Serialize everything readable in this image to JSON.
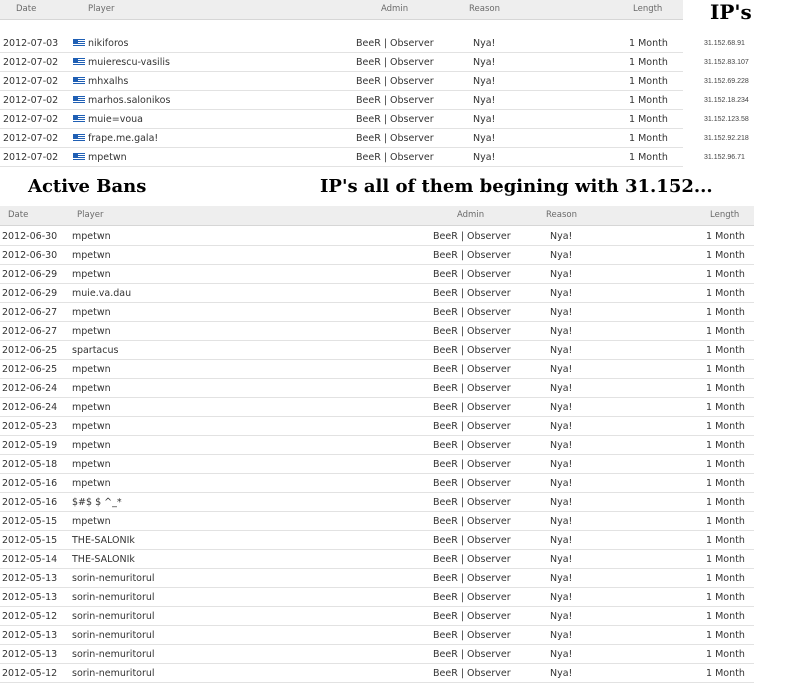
{
  "top_table": {
    "headers": {
      "date": "Date",
      "player": "Player",
      "admin": "Admin",
      "reason": "Reason",
      "length": "Length"
    },
    "rows": [
      {
        "date": "2012-07-03",
        "player": "nikiforos",
        "admin": "BeeR | Observer",
        "reason": "Nya!",
        "length": "1 Month"
      },
      {
        "date": "2012-07-02",
        "player": "muierescu-vasilis",
        "admin": "BeeR | Observer",
        "reason": "Nya!",
        "length": "1 Month"
      },
      {
        "date": "2012-07-02",
        "player": "mhxalhs",
        "admin": "BeeR | Observer",
        "reason": "Nya!",
        "length": "1 Month"
      },
      {
        "date": "2012-07-02",
        "player": "marhos.salonikos",
        "admin": "BeeR | Observer",
        "reason": "Nya!",
        "length": "1 Month"
      },
      {
        "date": "2012-07-02",
        "player": "muie=voua",
        "admin": "BeeR | Observer",
        "reason": "Nya!",
        "length": "1 Month"
      },
      {
        "date": "2012-07-02",
        "player": "frape.me.gala!",
        "admin": "BeeR | Observer",
        "reason": "Nya!",
        "length": "1 Month"
      },
      {
        "date": "2012-07-02",
        "player": "mpetwn",
        "admin": "BeeR | Observer",
        "reason": "Nya!",
        "length": "1 Month"
      }
    ]
  },
  "ips": {
    "title": "IP's",
    "values": [
      "31.152.68.91",
      "31.152.83.107",
      "31.152.69.228",
      "31.152.18.234",
      "31.152.123.58",
      "31.152.92.218",
      "31.152.96.71"
    ]
  },
  "annotations": {
    "active_bans": "Active Bans",
    "ips_note": "IP's all of them begining with 31.152..."
  },
  "bottom_table": {
    "headers": {
      "date": "Date",
      "player": "Player",
      "admin": "Admin",
      "reason": "Reason",
      "length": "Length"
    },
    "rows": [
      {
        "date": "2012-06-30",
        "player": "mpetwn",
        "admin": "BeeR | Observer",
        "reason": "Nya!",
        "length": "1 Month"
      },
      {
        "date": "2012-06-30",
        "player": "mpetwn",
        "admin": "BeeR | Observer",
        "reason": "Nya!",
        "length": "1 Month"
      },
      {
        "date": "2012-06-29",
        "player": "mpetwn",
        "admin": "BeeR | Observer",
        "reason": "Nya!",
        "length": "1 Month"
      },
      {
        "date": "2012-06-29",
        "player": "muie.va.dau",
        "admin": "BeeR | Observer",
        "reason": "Nya!",
        "length": "1 Month"
      },
      {
        "date": "2012-06-27",
        "player": "mpetwn",
        "admin": "BeeR | Observer",
        "reason": "Nya!",
        "length": "1 Month"
      },
      {
        "date": "2012-06-27",
        "player": "mpetwn",
        "admin": "BeeR | Observer",
        "reason": "Nya!",
        "length": "1 Month"
      },
      {
        "date": "2012-06-25",
        "player": "spartacus",
        "admin": "BeeR | Observer",
        "reason": "Nya!",
        "length": "1 Month"
      },
      {
        "date": "2012-06-25",
        "player": "mpetwn",
        "admin": "BeeR | Observer",
        "reason": "Nya!",
        "length": "1 Month"
      },
      {
        "date": "2012-06-24",
        "player": "mpetwn",
        "admin": "BeeR | Observer",
        "reason": "Nya!",
        "length": "1 Month"
      },
      {
        "date": "2012-06-24",
        "player": "mpetwn",
        "admin": "BeeR | Observer",
        "reason": "Nya!",
        "length": "1 Month"
      },
      {
        "date": "2012-05-23",
        "player": "mpetwn",
        "admin": "BeeR | Observer",
        "reason": "Nya!",
        "length": "1 Month"
      },
      {
        "date": "2012-05-19",
        "player": "mpetwn",
        "admin": "BeeR | Observer",
        "reason": "Nya!",
        "length": "1 Month"
      },
      {
        "date": "2012-05-18",
        "player": "mpetwn",
        "admin": "BeeR | Observer",
        "reason": "Nya!",
        "length": "1 Month"
      },
      {
        "date": "2012-05-16",
        "player": "mpetwn",
        "admin": "BeeR | Observer",
        "reason": "Nya!",
        "length": "1 Month"
      },
      {
        "date": "2012-05-16",
        "player": "$#$ $ ^_*",
        "admin": "BeeR | Observer",
        "reason": "Nya!",
        "length": "1 Month"
      },
      {
        "date": "2012-05-15",
        "player": "mpetwn",
        "admin": "BeeR | Observer",
        "reason": "Nya!",
        "length": "1 Month"
      },
      {
        "date": "2012-05-15",
        "player": "THE-SALONIk",
        "admin": "BeeR | Observer",
        "reason": "Nya!",
        "length": "1 Month"
      },
      {
        "date": "2012-05-14",
        "player": "THE-SALONIk",
        "admin": "BeeR | Observer",
        "reason": "Nya!",
        "length": "1 Month"
      },
      {
        "date": "2012-05-13",
        "player": "sorin-nemuritorul",
        "admin": "BeeR | Observer",
        "reason": "Nya!",
        "length": "1 Month"
      },
      {
        "date": "2012-05-13",
        "player": "sorin-nemuritorul",
        "admin": "BeeR | Observer",
        "reason": "Nya!",
        "length": "1 Month"
      },
      {
        "date": "2012-05-12",
        "player": "sorin-nemuritorul",
        "admin": "BeeR | Observer",
        "reason": "Nya!",
        "length": "1 Month"
      },
      {
        "date": "2012-05-13",
        "player": "sorin-nemuritorul",
        "admin": "BeeR | Observer",
        "reason": "Nya!",
        "length": "1 Month"
      },
      {
        "date": "2012-05-13",
        "player": "sorin-nemuritorul",
        "admin": "BeeR | Observer",
        "reason": "Nya!",
        "length": "1 Month"
      },
      {
        "date": "2012-05-12",
        "player": "sorin-nemuritorul",
        "admin": "BeeR | Observer",
        "reason": "Nya!",
        "length": "1 Month"
      }
    ]
  }
}
